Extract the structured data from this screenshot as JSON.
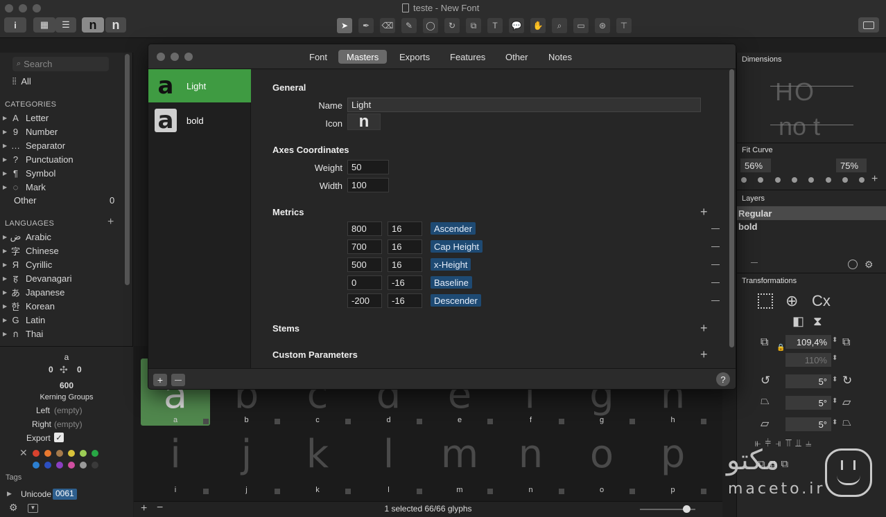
{
  "window": {
    "title": "teste - New Font"
  },
  "toolbar": {
    "info_label": "i",
    "glyph_n_label": "n",
    "glyph_n2_label": "n",
    "tool_icons": [
      "select-tool",
      "pen-tool",
      "eraser-tool",
      "pencil-tool",
      "shape-tool",
      "rotate-tool",
      "scale-tool",
      "text-tool",
      "annotation-tool",
      "hand-tool",
      "zoom-tool",
      "measure-tool",
      "component-tool",
      "kerning-tool"
    ]
  },
  "sidebar": {
    "search_placeholder": "Search",
    "all_label": "All",
    "categories_header": "CATEGORIES",
    "categories": [
      {
        "icon": "A",
        "label": "Letter"
      },
      {
        "icon": "9",
        "label": "Number"
      },
      {
        "icon": "…",
        "label": "Separator"
      },
      {
        "icon": "?",
        "label": "Punctuation"
      },
      {
        "icon": "¶",
        "label": "Symbol"
      },
      {
        "icon": "◌",
        "label": "Mark"
      }
    ],
    "other_label": "Other",
    "other_count": "0",
    "languages_header": "LANGUAGES",
    "languages": [
      {
        "icon": "ض",
        "label": "Arabic"
      },
      {
        "icon": "字",
        "label": "Chinese"
      },
      {
        "icon": "Я",
        "label": "Cyrillic"
      },
      {
        "icon": "ह",
        "label": "Devanagari"
      },
      {
        "icon": "あ",
        "label": "Japanese"
      },
      {
        "icon": "한",
        "label": "Korean"
      },
      {
        "icon": "G",
        "label": "Latin"
      },
      {
        "icon": "ก",
        "label": "Thai"
      }
    ]
  },
  "inspector": {
    "glyph_name": "a",
    "lsb": "0",
    "rsb": "0",
    "width": "600",
    "kerning_groups_label": "Kerning Groups",
    "left_label": "Left",
    "left_value": "(empty)",
    "right_label": "Right",
    "right_value": "(empty)",
    "export_label": "Export",
    "tags_label": "Tags",
    "unicode_label": "Unicode",
    "unicode_value": "0061",
    "colors": [
      "#d8422e",
      "#e8792f",
      "#a57a4b",
      "#d8c23b",
      "#9ccc55",
      "#28a745",
      "#2c7fd0",
      "#2c4fc0",
      "#8a3fc0",
      "#d04fa0",
      "#9a9a9a",
      "#3a3a3a"
    ]
  },
  "dialog": {
    "tabs": [
      "Font",
      "Masters",
      "Exports",
      "Features",
      "Other",
      "Notes"
    ],
    "active_tab": "Masters",
    "masters": [
      {
        "icon": "a",
        "label": "Light"
      },
      {
        "icon": "a",
        "label": "bold"
      }
    ],
    "general_header": "General",
    "name_label": "Name",
    "name_value": "Light",
    "icon_label": "Icon",
    "icon_value": "n",
    "axes_header": "Axes Coordinates",
    "weight_label": "Weight",
    "weight_value": "50",
    "width_label": "Width",
    "width_value": "100",
    "metrics_header": "Metrics",
    "metrics": [
      {
        "value": "800",
        "overshoot": "16",
        "name": "Ascender"
      },
      {
        "value": "700",
        "overshoot": "16",
        "name": "Cap Height"
      },
      {
        "value": "500",
        "overshoot": "16",
        "name": "x-Height"
      },
      {
        "value": "0",
        "overshoot": "-16",
        "name": "Baseline"
      },
      {
        "value": "-200",
        "overshoot": "-16",
        "name": "Descender"
      }
    ],
    "stems_header": "Stems",
    "custom_header": "Custom Parameters",
    "add_label": "+",
    "remove_label": "—",
    "help_label": "?"
  },
  "grid": {
    "row1": [
      {
        "glyph": "a",
        "name": "a"
      },
      {
        "glyph": "b",
        "name": "b"
      },
      {
        "glyph": "c",
        "name": "c"
      },
      {
        "glyph": "d",
        "name": "d"
      },
      {
        "glyph": "e",
        "name": "e"
      },
      {
        "glyph": "f",
        "name": "f"
      },
      {
        "glyph": "g",
        "name": "g"
      },
      {
        "glyph": "h",
        "name": "h"
      }
    ],
    "row2": [
      {
        "glyph": "i",
        "name": "i"
      },
      {
        "glyph": "j",
        "name": "j"
      },
      {
        "glyph": "k",
        "name": "k"
      },
      {
        "glyph": "l",
        "name": "l"
      },
      {
        "glyph": "m",
        "name": "m"
      },
      {
        "glyph": "n",
        "name": "n"
      },
      {
        "glyph": "o",
        "name": "o"
      },
      {
        "glyph": "p",
        "name": "p"
      }
    ],
    "status": "1 selected 66/66 glyphs"
  },
  "right_panel": {
    "dimensions_label": "Dimensions",
    "dim_preview_top": "HO",
    "dim_preview_bottom": "no t",
    "fit_curve_label": "Fit Curve",
    "fit_left": "56%",
    "fit_right": "75%",
    "layers_label": "Layers",
    "layers": [
      "Regular",
      "bold"
    ],
    "transformations_label": "Transformations",
    "scale_value": "109,4%",
    "scale_value2": "110%",
    "rotate_value": "5°",
    "skew_value": "5°",
    "slant_value": "5°",
    "cx_label": "Cx"
  },
  "watermark": {
    "brand_fa": "مکتو",
    "brand_en": "maceto.ir"
  }
}
